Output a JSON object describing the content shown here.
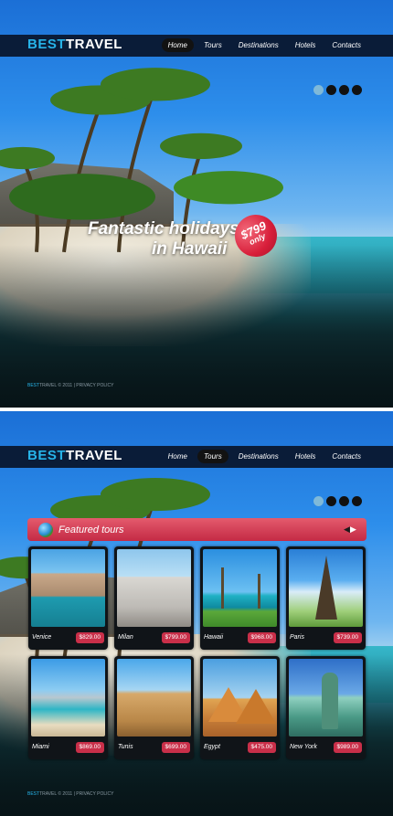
{
  "brand": {
    "part1": "BEST",
    "part2": "TRAVEL"
  },
  "nav": [
    "Home",
    "Tours",
    "Destinations",
    "Hotels",
    "Contacts"
  ],
  "frame1": {
    "active_nav": 0,
    "headline_line1": "Fantastic holidays",
    "headline_line2": "in Hawaii",
    "price": "$799",
    "price_suffix": "only",
    "slider_dots": 4,
    "active_dot": 0
  },
  "frame2": {
    "active_nav": 1,
    "featured_title": "Featured tours",
    "tours": [
      {
        "name": "Venice",
        "price": "$829.00"
      },
      {
        "name": "Milan",
        "price": "$799.00"
      },
      {
        "name": "Hawaii",
        "price": "$968.00"
      },
      {
        "name": "Paris",
        "price": "$739.00"
      },
      {
        "name": "Miami",
        "price": "$869.00"
      },
      {
        "name": "Tunis",
        "price": "$699.00"
      },
      {
        "name": "Egypt",
        "price": "$475.00"
      },
      {
        "name": "New York",
        "price": "$989.00"
      }
    ]
  },
  "footer": {
    "brand1": "BEST",
    "brand2": "TRAVEL",
    "copyright": "© 2011",
    "separator": "|",
    "privacy": "PRIVACY POLICY"
  },
  "colors": {
    "accent_blue": "#27b3e8",
    "accent_red": "#c92f49",
    "nav_bg": "#08122b"
  }
}
